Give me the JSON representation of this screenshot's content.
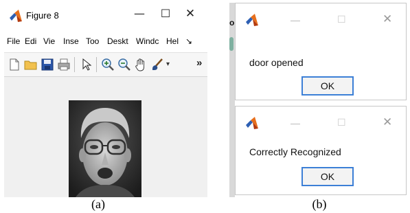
{
  "panel_a": {
    "window_title": "Figure 8",
    "controls": {
      "minimize": "—",
      "maximize": "☐",
      "close": "✕"
    },
    "menu": [
      "File",
      "Edi",
      "Vie",
      "Inse",
      "Too",
      "Deskt",
      "Windc",
      "Hel",
      "↘"
    ],
    "toolbar_icons": [
      "new-file-icon",
      "open-folder-icon",
      "save-icon",
      "print-icon",
      "pointer-icon",
      "zoom-in-icon",
      "zoom-out-icon",
      "pan-hand-icon",
      "brush-icon"
    ],
    "toolbar_overflow": "»",
    "toolbar_dropdown": "▾",
    "image": "face photograph"
  },
  "panel_b": {
    "side_text": "o",
    "dialogs": [
      {
        "message": "door opened",
        "button": "OK"
      },
      {
        "message": "Correctly Recognized",
        "button": "OK"
      }
    ],
    "dialog_controls": {
      "minimize": "—",
      "maximize": "☐",
      "close": "✕"
    }
  },
  "captions": {
    "a": "(a)",
    "b": "(b)"
  },
  "colors": {
    "matlab_orange": "#e76f1c",
    "matlab_blue": "#2d5fb3",
    "ok_border": "#3c7fd6",
    "canvas_bg": "#f0f0f0"
  }
}
